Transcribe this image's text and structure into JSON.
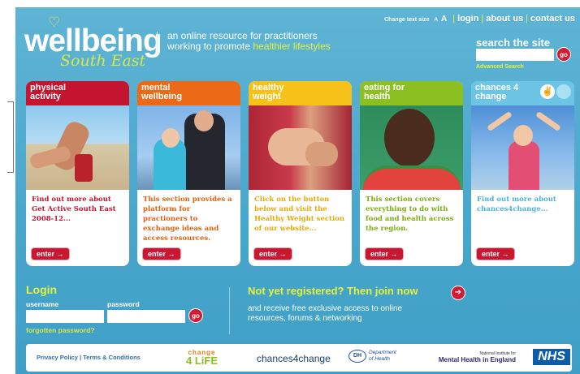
{
  "brand": {
    "name": "wellbeing",
    "region": "South East",
    "tagline_line1": "an online resource for practitioners",
    "tagline_line2_prefix": "working to promote ",
    "tagline_line2_highlight": "healthier lifestyles"
  },
  "topnav": {
    "change_text_size": "Change text size",
    "a_small": "A",
    "a_large": "A",
    "login": "login",
    "about": "about us",
    "contact": "contact us"
  },
  "search": {
    "title": "search the site",
    "value": "",
    "go": "go",
    "advanced": "Advanced Search"
  },
  "cards": [
    {
      "title_line1": "physical",
      "title_line2": "activity",
      "text": "Find out more about Get Active South East 2008-12...",
      "enter": "enter →"
    },
    {
      "title_line1": "mental",
      "title_line2": "wellbeing",
      "text": "This section provides a platform for practioners to exchange ideas and access resources.",
      "enter": "enter →"
    },
    {
      "title_line1": "healthy",
      "title_line2": "weight",
      "text": "Click on the button below and visit the Healthy Weight section of our website...",
      "enter": "enter →"
    },
    {
      "title_line1": "eating for",
      "title_line2": "health",
      "text": "This section covers everything to do with food and health across the region.",
      "enter": "enter →"
    },
    {
      "title_line1": "chances 4",
      "title_line2": "change",
      "text": "Find out more about chances4change...",
      "enter": "enter →"
    }
  ],
  "login": {
    "title": "Login",
    "username_label": "username",
    "password_label": "password",
    "username_value": "",
    "password_value": "",
    "go": "go",
    "forgot": "forgotten password?"
  },
  "join": {
    "title": "Not yet registered? Then join now",
    "desc": "and receive free exclusive access to online resources, forums & networking",
    "arrow": "➔"
  },
  "footer": {
    "links": "Privacy Policy | Terms & Conditions",
    "change4life_top": "change",
    "change4life_bottom": "4 LiFE",
    "chances4change": "chances4change",
    "dh_badge": "DH",
    "dh_text1": "Department",
    "dh_text2": "of Health",
    "mh_small": "National Institute for",
    "mh_main": "Mental Health in England",
    "nhs": "NHS"
  }
}
